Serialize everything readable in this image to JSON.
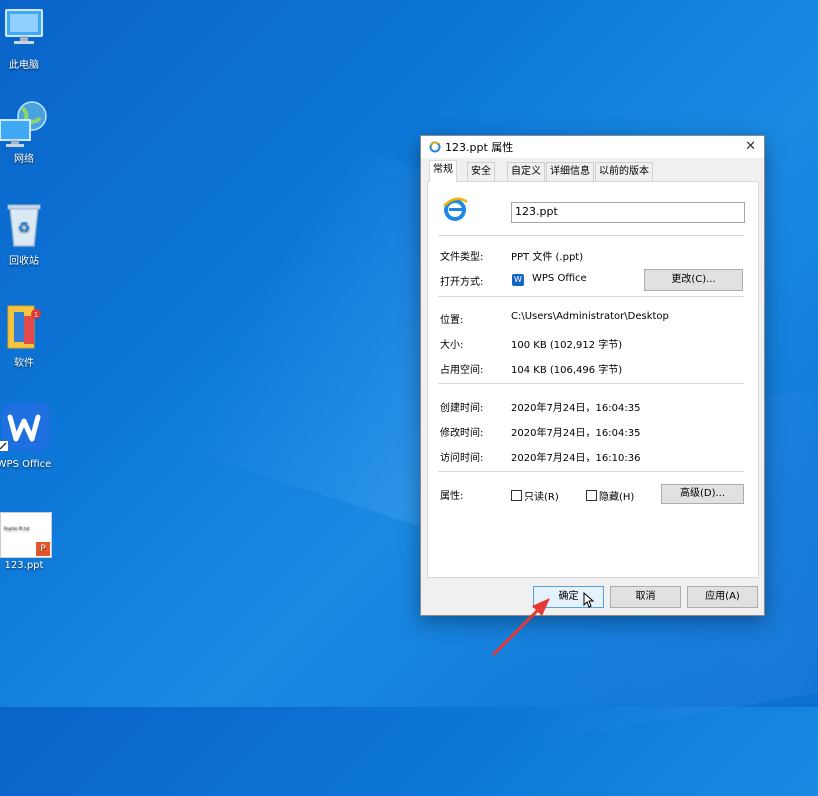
{
  "desktop": {
    "icons": [
      {
        "label": "此电脑"
      },
      {
        "label": "网络"
      },
      {
        "label": "回收站"
      },
      {
        "label": "软件"
      },
      {
        "label": "WPS Office"
      },
      {
        "label": "123.ppt"
      }
    ],
    "ppt_thumb_text": "Peptile Pt.tot"
  },
  "dialog": {
    "title": "123.ppt 属性",
    "close_glyph": "✕",
    "tabs": [
      "常规",
      "安全",
      "自定义",
      "详细信息",
      "以前的版本"
    ],
    "filename": "123.ppt",
    "file_type_label": "文件类型:",
    "file_type_value": "PPT 文件 (.ppt)",
    "open_with_label": "打开方式:",
    "open_with_value": "WPS Office",
    "change_button": "更改(C)...",
    "location_label": "位置:",
    "location_value": "C:\\Users\\Administrator\\Desktop",
    "size_label": "大小:",
    "size_value": "100 KB (102,912 字节)",
    "size_on_disk_label": "占用空间:",
    "size_on_disk_value": "104 KB (106,496 字节)",
    "created_label": "创建时间:",
    "created_value": "2020年7月24日，16:04:35",
    "modified_label": "修改时间:",
    "modified_value": "2020年7月24日，16:04:35",
    "accessed_label": "访问时间:",
    "accessed_value": "2020年7月24日，16:10:36",
    "attributes_label": "属性:",
    "readonly_label": "只读(R)",
    "hidden_label": "隐藏(H)",
    "advanced_button": "高级(D)...",
    "ok_button": "确定",
    "cancel_button": "取消",
    "apply_button": "应用(A)"
  },
  "colors": {
    "desktop_blue": "#0d78d8",
    "annotation_arrow": "#e53935",
    "ie_blue": "#1e88e5",
    "wps_blue": "#1565c0"
  }
}
